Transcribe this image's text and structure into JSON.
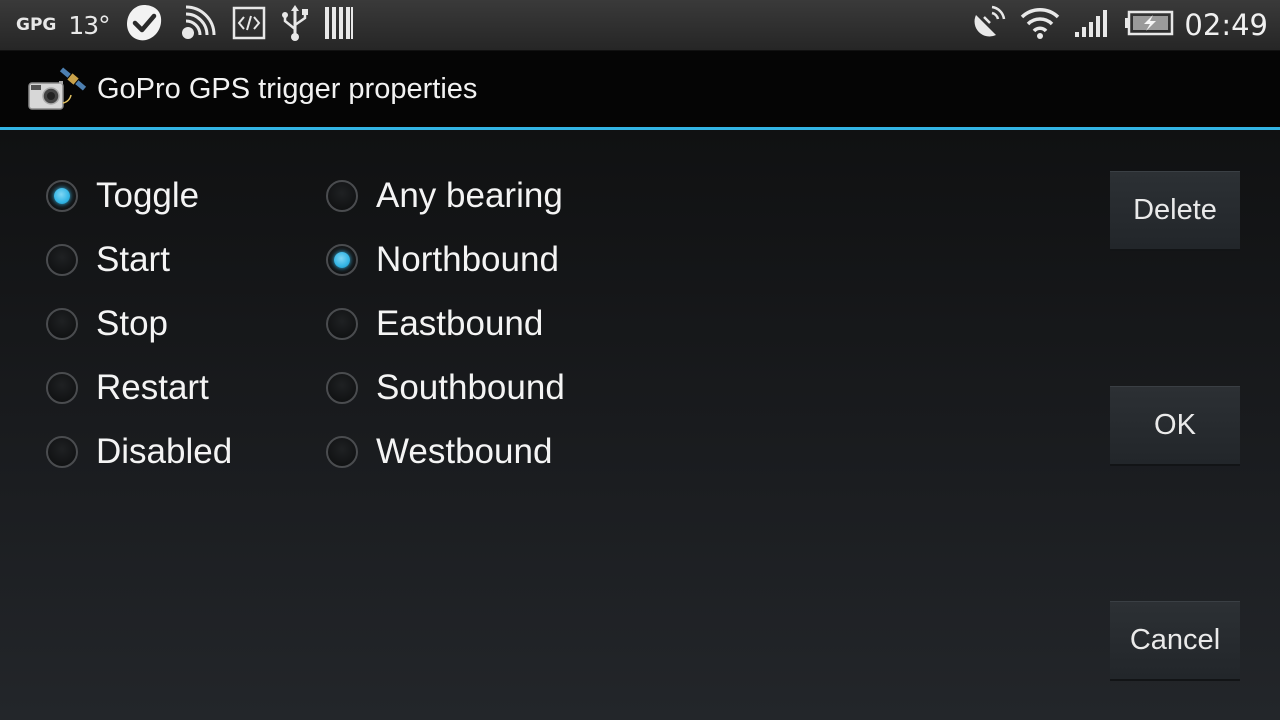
{
  "status_bar": {
    "carrier": "GPG",
    "temperature": "13°",
    "icons_left": [
      "checkmark-app-icon",
      "satellite-signal-icon",
      "code-icon",
      "usb-icon",
      "barcode-icon"
    ],
    "icons_right": [
      "gps-icon",
      "wifi-icon",
      "signal-bars-icon",
      "battery-charging-icon"
    ],
    "time": "02:49"
  },
  "titlebar": {
    "title": "GoPro GPS trigger properties",
    "icon": "gopro-satellite-icon"
  },
  "accent_color": "#33b5e5",
  "action_group": {
    "options": [
      {
        "label": "Toggle",
        "checked": true
      },
      {
        "label": "Start",
        "checked": false
      },
      {
        "label": "Stop",
        "checked": false
      },
      {
        "label": "Restart",
        "checked": false
      },
      {
        "label": "Disabled",
        "checked": false
      }
    ]
  },
  "bearing_group": {
    "options": [
      {
        "label": "Any bearing",
        "checked": false
      },
      {
        "label": "Northbound",
        "checked": true
      },
      {
        "label": "Eastbound",
        "checked": false
      },
      {
        "label": "Southbound",
        "checked": false
      },
      {
        "label": "Westbound",
        "checked": false
      }
    ]
  },
  "buttons": {
    "delete": "Delete",
    "ok": "OK",
    "cancel": "Cancel"
  }
}
